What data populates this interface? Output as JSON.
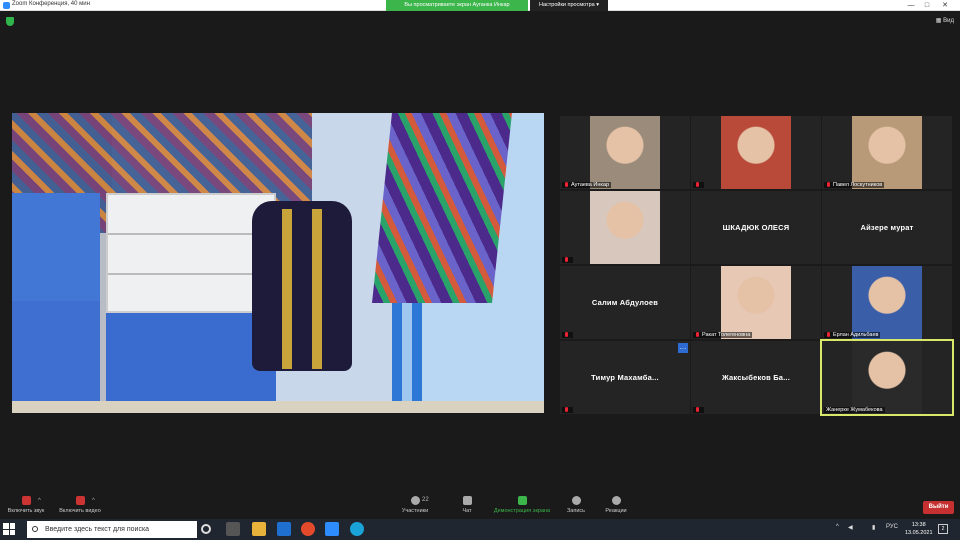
{
  "window": {
    "title": "Zoom Конференция, 40 мин",
    "controls": [
      "—",
      "□",
      "✕"
    ]
  },
  "banner": {
    "sharing": "Вы просматриваете экран Ауганка Инкар",
    "view_options": "Настройки просмотра ▾"
  },
  "view_label": "Вид",
  "participants": [
    {
      "name": "Аутаева Инкар",
      "label": "Аутаева Инкар",
      "muted": true,
      "has_video": true,
      "color": "#9a8b7a"
    },
    {
      "name": "",
      "label": "",
      "muted": true,
      "has_video": true,
      "color": "#b94a3a"
    },
    {
      "name": "Павел Лоскутников",
      "label": "Павел Лоскутников",
      "muted": true,
      "has_video": true,
      "color": "#b89a78"
    },
    {
      "name": "",
      "label": "",
      "muted": true,
      "has_video": true,
      "color": "#d8c7bd"
    },
    {
      "name": "ШКАДЮК ОЛЕСЯ",
      "label": "",
      "muted": false,
      "has_video": false
    },
    {
      "name": "Айзере мурат",
      "label": "",
      "muted": false,
      "has_video": false
    },
    {
      "name": "Салим Абдулоев",
      "label": "",
      "muted": true,
      "has_video": false
    },
    {
      "name": "Ракат Толегеновна",
      "label": "Ракат Толегеновна",
      "muted": true,
      "has_video": true,
      "color": "#e7c8b4"
    },
    {
      "name": "Ерлан Адильбаев",
      "label": "Ерлан Адильбаев",
      "muted": true,
      "has_video": true,
      "color": "#3a5ea8"
    },
    {
      "name": "Тимур Махамба...",
      "label": "",
      "muted": true,
      "has_video": false
    },
    {
      "name": "Жаксыбеков Ба...",
      "label": "",
      "muted": true,
      "has_video": false
    },
    {
      "name": "Жанерке Жумабекова",
      "label": "Жанерке Жумабекова",
      "muted": false,
      "has_video": true,
      "color": "#2a2a2a"
    }
  ],
  "toolbar": {
    "audio": "Включить звук",
    "video": "Включить видео",
    "participants": "Участники",
    "participants_count": "22",
    "chat": "Чат",
    "share": "Демонстрация экрана",
    "record": "Запись",
    "reactions": "Реакции",
    "leave": "Выйти"
  },
  "taskbar": {
    "search_placeholder": "Введите здесь текст для поиска",
    "language": "РУС",
    "time": "13:38",
    "date": "13.05.2021",
    "notifications": "2"
  },
  "colors": {
    "share_green": "#3cb54b",
    "leave_red": "#c73030",
    "active_outline": "#d9e868",
    "taskbar": "#20262f"
  }
}
